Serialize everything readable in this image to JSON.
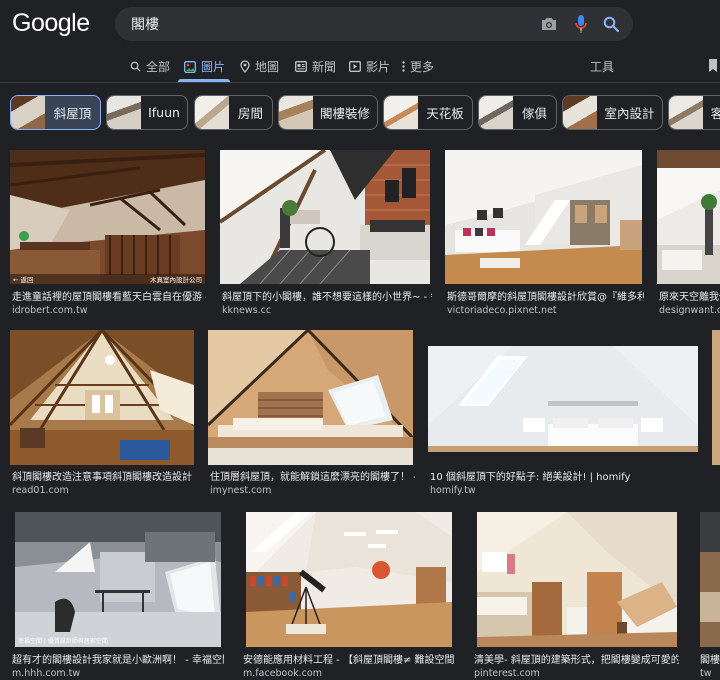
{
  "search": {
    "logo": "Google",
    "query": "閣樓"
  },
  "tabs": [
    {
      "label": "全部",
      "icon": "search-icon"
    },
    {
      "label": "圖片",
      "icon": "image-icon",
      "active": true
    },
    {
      "label": "地圖",
      "icon": "map-pin-icon"
    },
    {
      "label": "新聞",
      "icon": "news-icon"
    },
    {
      "label": "影片",
      "icon": "play-icon"
    },
    {
      "label": "更多",
      "icon": "more-icon"
    },
    {
      "label": "工具"
    }
  ],
  "chips": [
    {
      "label": "斜屋頂",
      "selected": true
    },
    {
      "label": "Ifuun"
    },
    {
      "label": "房間"
    },
    {
      "label": "閣樓裝修"
    },
    {
      "label": "天花板"
    },
    {
      "label": "傢俱"
    },
    {
      "label": "室內設計"
    },
    {
      "label": "客"
    }
  ],
  "results": [
    {
      "caption": "走進童話裡的屋頂閣樓看藍天白雲自在優游 - ...",
      "source": "idrobert.com.tw",
      "overlay_left": "← 返回",
      "overlay_right": "木真室內設計公司"
    },
    {
      "caption": "斜屋頂下的小閣樓，誰不想要這樣的小世界~ - 每...",
      "source": "kknews.cc"
    },
    {
      "caption": "斯德哥爾摩的斜屋頂閣樓設計欣賞@『維多利...",
      "source": "victoriadeco.pixnet.net"
    },
    {
      "caption": "原來天空離我們",
      "source": "designwant.co"
    },
    {
      "caption": "斜頂閣樓改造注意事項斜頂閣樓改造設計 ...",
      "source": "read01.com"
    },
    {
      "caption": "住頂層斜屋頂，就能解鎖這麼漂亮的閣樓了！ - ...",
      "source": "imynest.com"
    },
    {
      "caption": "10 個斜屋頂下的好點子: 絕美設計! | homify",
      "source": "homify.tw"
    },
    {
      "caption": "超有才的閣樓設計我家就是小歐洲啊！ - 幸福空間",
      "source": "m.hhh.com.tw",
      "overlay_left": "幸福空間 | 優質設計師與居家空間"
    },
    {
      "caption": "安德能應用材料工程 - 【斜屋頂閣樓≠ 難設空間】...",
      "source": "m.facebook.com"
    },
    {
      "caption": "清美學- 斜屋頂的建築形式，把閣樓變成可愛的小...",
      "source": "pinterest.com"
    },
    {
      "caption": "閣樓",
      "source": "tw"
    }
  ],
  "colors": {
    "background": "#202124",
    "accent": "#8ab4f8",
    "searchbar": "#303134",
    "mic_red": "#ea4335",
    "mic_yellow": "#fbbc04",
    "mic_green": "#34a853"
  }
}
